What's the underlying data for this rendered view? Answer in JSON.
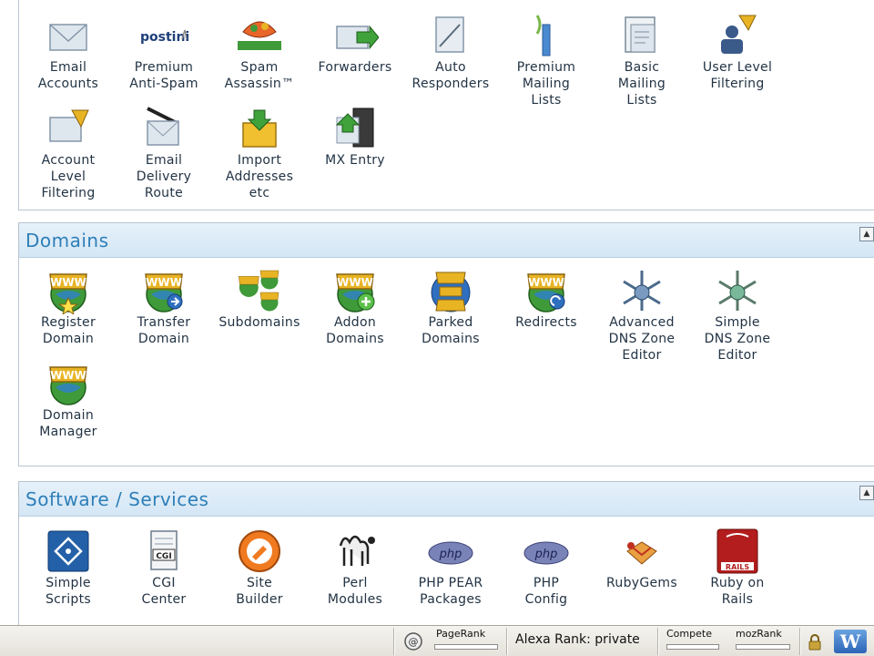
{
  "email": {
    "items": [
      {
        "label": "Email\nAccounts",
        "icon": "envelope-icon"
      },
      {
        "label": "Premium\nAnti-Spam",
        "icon": "postini-logo",
        "logo_text": "postini"
      },
      {
        "label": "Spam\nAssassin™",
        "icon": "spamassassin-logo",
        "logo_text": "SpamAssassin"
      },
      {
        "label": "Forwarders",
        "icon": "forward-envelope-icon"
      },
      {
        "label": "Auto\nResponders",
        "icon": "autoresponder-icon"
      },
      {
        "label": "Premium\nMailing\nLists",
        "icon": "mailing-list-icon"
      },
      {
        "label": "Basic\nMailing\nLists",
        "icon": "basic-list-icon"
      },
      {
        "label": "User Level\nFiltering",
        "icon": "user-filter-icon"
      },
      {
        "label": "Account\nLevel\nFiltering",
        "icon": "account-filter-icon"
      },
      {
        "label": "Email\nDelivery\nRoute",
        "icon": "delivery-route-icon"
      },
      {
        "label": "Import\nAddresses\netc",
        "icon": "import-box-icon"
      },
      {
        "label": "MX Entry",
        "icon": "mx-entry-icon"
      }
    ]
  },
  "domains": {
    "title": "Domains",
    "items": [
      {
        "label": "Register\nDomain",
        "icon": "www-star-icon"
      },
      {
        "label": "Transfer\nDomain",
        "icon": "www-transfer-icon"
      },
      {
        "label": "Subdomains",
        "icon": "www-multi-icon"
      },
      {
        "label": "Addon\nDomains",
        "icon": "www-add-icon"
      },
      {
        "label": "Parked\nDomains",
        "icon": "www-parked-icon"
      },
      {
        "label": "Redirects",
        "icon": "www-redirect-icon"
      },
      {
        "label": "Advanced\nDNS Zone\nEditor",
        "icon": "dns-network-icon"
      },
      {
        "label": "Simple\nDNS Zone\nEditor",
        "icon": "dns-simple-icon"
      },
      {
        "label": "Domain\nManager",
        "icon": "www-manager-icon"
      }
    ]
  },
  "software": {
    "title": "Software / Services",
    "items": [
      {
        "label": "Simple\nScripts",
        "icon": "simple-scripts-icon"
      },
      {
        "label": "CGI\nCenter",
        "icon": "cgi-document-icon"
      },
      {
        "label": "Site\nBuilder",
        "icon": "site-builder-icon"
      },
      {
        "label": "Perl\nModules",
        "icon": "camel-icon"
      },
      {
        "label": "PHP PEAR\nPackages",
        "icon": "php-pear-icon",
        "logo_text": "php"
      },
      {
        "label": "PHP\nConfig",
        "icon": "php-config-icon",
        "logo_text": "php"
      },
      {
        "label": "RubyGems",
        "icon": "ruby-gems-icon"
      },
      {
        "label": "Ruby on\nRails",
        "icon": "rails-icon",
        "logo_text": "RAILS"
      }
    ]
  },
  "collapse_glyph": "▲",
  "statusbar": {
    "pagerank": "PageRank",
    "alexa": "Alexa Rank: private",
    "compete": "Compete",
    "mozrank": "mozRank",
    "w_logo": "W"
  },
  "colors": {
    "header_title": "#2d7fb8",
    "header_bg": "#d9e9f6",
    "www_gold": "#e8b424",
    "globe_green": "#3f9a3a"
  }
}
